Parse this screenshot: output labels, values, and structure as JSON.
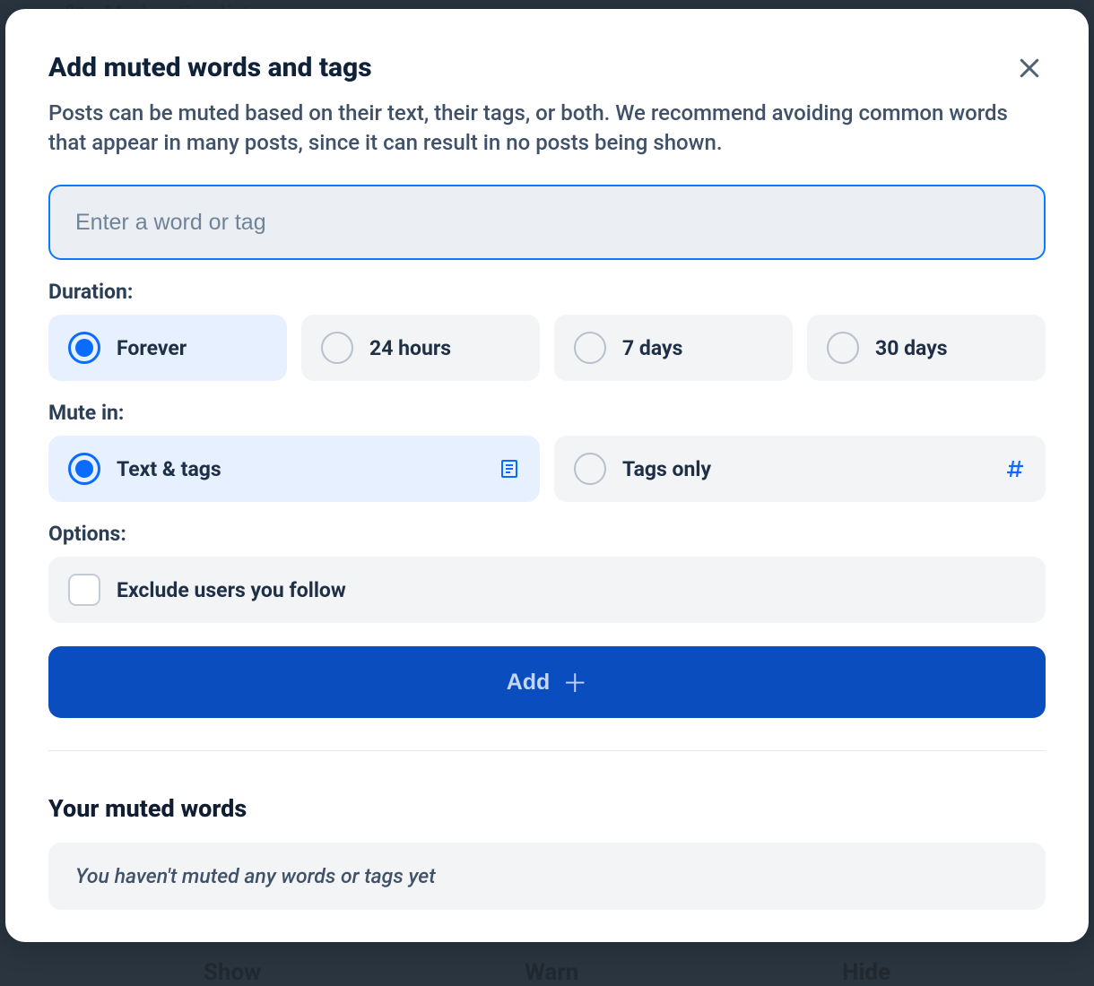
{
  "backdrop": {
    "top_label": "Moderation lists",
    "bottom_show": "Show",
    "bottom_warn": "Warn",
    "bottom_hide": "Hide"
  },
  "modal": {
    "title": "Add muted words and tags",
    "description": "Posts can be muted based on their text, their tags, or both. We recommend avoiding common words that appear in many posts, since it can result in no posts being shown.",
    "input_placeholder": "Enter a word or tag",
    "input_value": "",
    "duration_label": "Duration:",
    "durations": {
      "forever": "Forever",
      "h24": "24 hours",
      "d7": "7 days",
      "d30": "30 days"
    },
    "mute_in_label": "Mute in:",
    "mute_in": {
      "text_tags": "Text & tags",
      "tags_only": "Tags only"
    },
    "options_label": "Options:",
    "option_exclude": "Exclude users you follow",
    "add_button": "Add",
    "muted_section_title": "Your muted words",
    "empty_state": "You haven't muted any words or tags yet"
  }
}
